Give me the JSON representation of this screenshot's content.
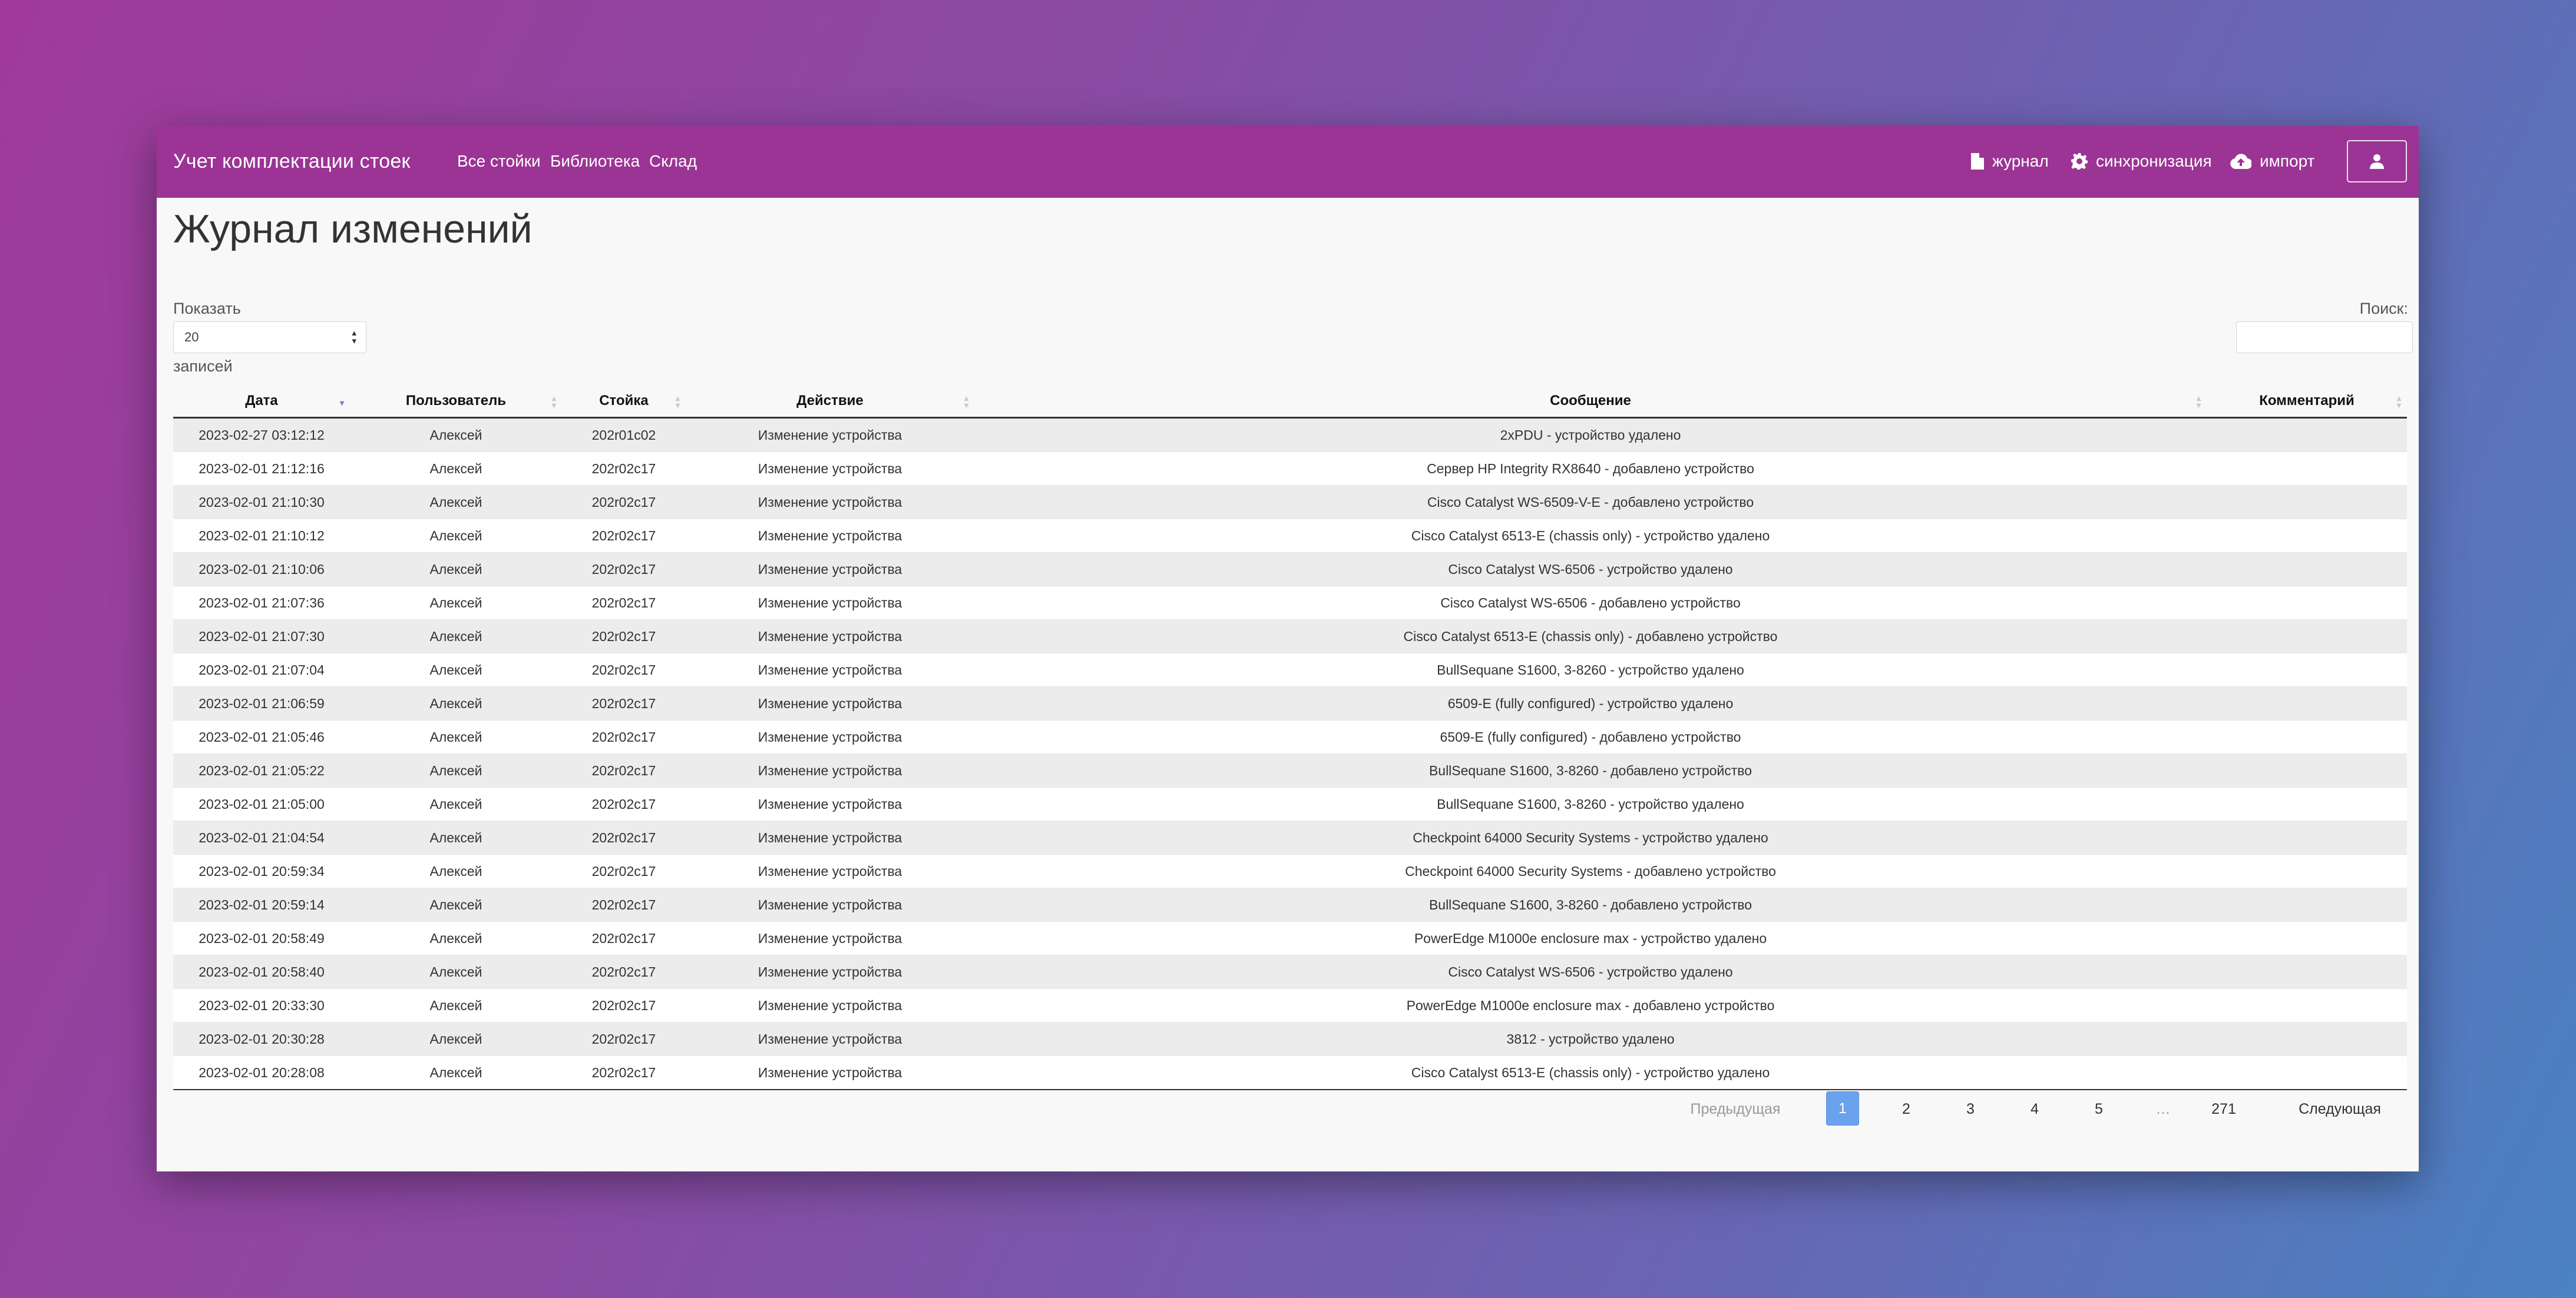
{
  "navbar": {
    "brand": "Учет комплектации стоек",
    "links": [
      "Все стойки",
      "Библиотека",
      "Склад"
    ],
    "right": [
      {
        "label": "журнал",
        "icon": "file-icon"
      },
      {
        "label": "синхронизация",
        "icon": "gear-icon"
      },
      {
        "label": "импорт",
        "icon": "cloud-upload-icon"
      }
    ],
    "user_icon": "user-icon",
    "color": "#9b3494"
  },
  "page": {
    "title": "Журнал изменений"
  },
  "controls": {
    "length_label": "Показать",
    "length_value": "20",
    "length_suffix": "записей",
    "search_label": "Поиск:",
    "search_value": ""
  },
  "table": {
    "columns": [
      "Дата",
      "Пользователь",
      "Стойка",
      "Действие",
      "Сообщение",
      "Комментарий"
    ],
    "sorted_column": "Дата",
    "rows": [
      [
        "2023-02-27 03:12:12",
        "Алексей",
        "202r01c02",
        "Изменение устройства",
        "2xPDU - устройство удалено",
        ""
      ],
      [
        "2023-02-01 21:12:16",
        "Алексей",
        "202r02c17",
        "Изменение устройства",
        "Сервер HP Integrity RX8640 - добавлено устройство",
        ""
      ],
      [
        "2023-02-01 21:10:30",
        "Алексей",
        "202r02c17",
        "Изменение устройства",
        "Cisco Catalyst WS-6509-V-E - добавлено устройство",
        ""
      ],
      [
        "2023-02-01 21:10:12",
        "Алексей",
        "202r02c17",
        "Изменение устройства",
        "Cisco Catalyst 6513-E (chassis only) - устройство удалено",
        ""
      ],
      [
        "2023-02-01 21:10:06",
        "Алексей",
        "202r02c17",
        "Изменение устройства",
        "Cisco Catalyst WS-6506 - устройство удалено",
        ""
      ],
      [
        "2023-02-01 21:07:36",
        "Алексей",
        "202r02c17",
        "Изменение устройства",
        "Cisco Catalyst WS-6506 - добавлено устройство",
        ""
      ],
      [
        "2023-02-01 21:07:30",
        "Алексей",
        "202r02c17",
        "Изменение устройства",
        "Cisco Catalyst 6513-E (chassis only) - добавлено устройство",
        ""
      ],
      [
        "2023-02-01 21:07:04",
        "Алексей",
        "202r02c17",
        "Изменение устройства",
        "BullSequane S1600, 3-8260 - устройство удалено",
        ""
      ],
      [
        "2023-02-01 21:06:59",
        "Алексей",
        "202r02c17",
        "Изменение устройства",
        "6509-E (fully configured) - устройство удалено",
        ""
      ],
      [
        "2023-02-01 21:05:46",
        "Алексей",
        "202r02c17",
        "Изменение устройства",
        "6509-E (fully configured) - добавлено устройство",
        ""
      ],
      [
        "2023-02-01 21:05:22",
        "Алексей",
        "202r02c17",
        "Изменение устройства",
        "BullSequane S1600, 3-8260 - добавлено устройство",
        ""
      ],
      [
        "2023-02-01 21:05:00",
        "Алексей",
        "202r02c17",
        "Изменение устройства",
        "BullSequane S1600, 3-8260 - устройство удалено",
        ""
      ],
      [
        "2023-02-01 21:04:54",
        "Алексей",
        "202r02c17",
        "Изменение устройства",
        "Checkpoint 64000 Security Systems - устройство удалено",
        ""
      ],
      [
        "2023-02-01 20:59:34",
        "Алексей",
        "202r02c17",
        "Изменение устройства",
        "Checkpoint 64000 Security Systems - добавлено устройство",
        ""
      ],
      [
        "2023-02-01 20:59:14",
        "Алексей",
        "202r02c17",
        "Изменение устройства",
        "BullSequane S1600, 3-8260 - добавлено устройство",
        ""
      ],
      [
        "2023-02-01 20:58:49",
        "Алексей",
        "202r02c17",
        "Изменение устройства",
        "PowerEdge M1000e enclosure max - устройство удалено",
        ""
      ],
      [
        "2023-02-01 20:58:40",
        "Алексей",
        "202r02c17",
        "Изменение устройства",
        "Cisco Catalyst WS-6506 - устройство удалено",
        ""
      ],
      [
        "2023-02-01 20:33:30",
        "Алексей",
        "202r02c17",
        "Изменение устройства",
        "PowerEdge M1000e enclosure max - добавлено устройство",
        ""
      ],
      [
        "2023-02-01 20:30:28",
        "Алексей",
        "202r02c17",
        "Изменение устройства",
        "3812 - устройство удалено",
        ""
      ],
      [
        "2023-02-01 20:28:08",
        "Алексей",
        "202r02c17",
        "Изменение устройства",
        "Cisco Catalyst 6513-E (chassis only) - устройство удалено",
        ""
      ]
    ]
  },
  "pagination": {
    "previous": "Предыдущая",
    "pages": [
      "1",
      "2",
      "3",
      "4",
      "5",
      "…",
      "271"
    ],
    "current": "1",
    "next": "Следующая"
  }
}
